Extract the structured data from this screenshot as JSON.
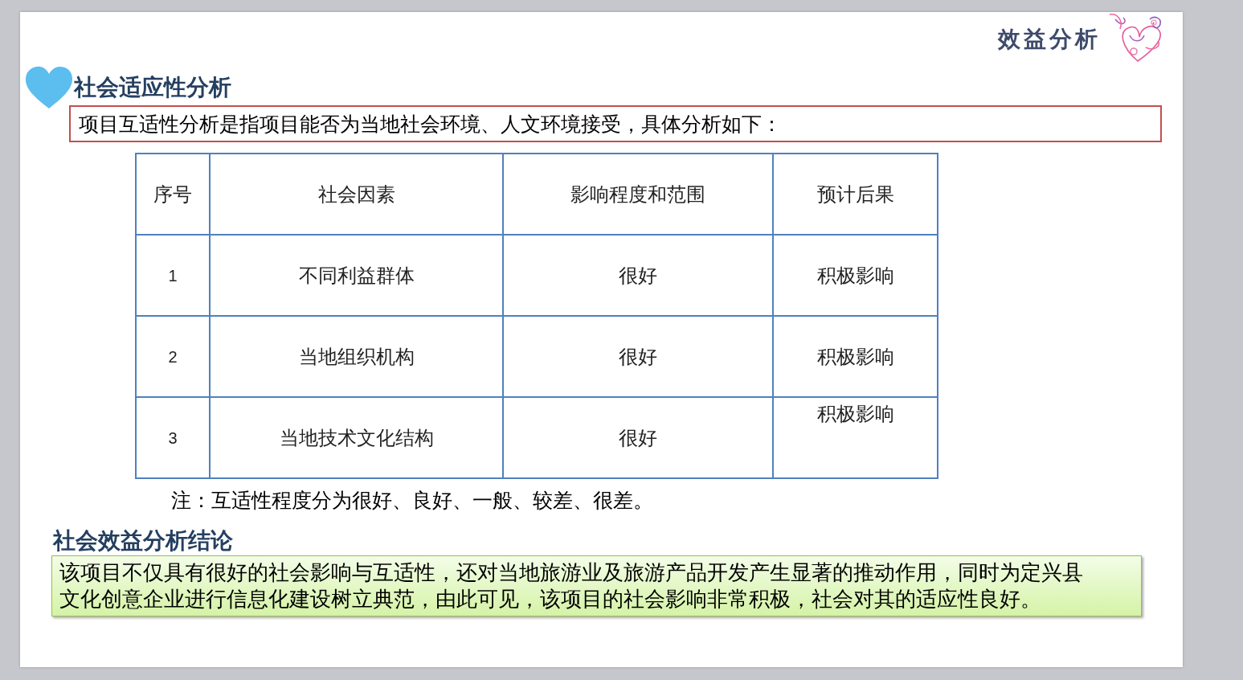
{
  "header": {
    "section_title": "效益分析"
  },
  "adaptability": {
    "heading": "社会适应性分析",
    "intro": "项目互适性分析是指项目能否为当地社会环境、人文环境接受，具体分析如下：",
    "table": {
      "columns": [
        "序号",
        "社会因素",
        "影响程度和范围",
        "预计后果"
      ],
      "rows": [
        [
          "1",
          "不同利益群体",
          "很好",
          "积极影响"
        ],
        [
          "2",
          "当地组织机构",
          "很好",
          "积极影响"
        ],
        [
          "3",
          "当地技术文化结构",
          "很好",
          "积极影响"
        ]
      ]
    },
    "note": "注：互适性程度分为很好、良好、一般、较差、很差。"
  },
  "conclusion": {
    "heading": "社会效益分析结论",
    "lines": [
      "该项目不仅具有很好的社会影响与互适性，还对当地旅游业及旅游产品开发产生显著的推动作用，同时为定兴县",
      "文化创意企业进行信息化建设树立典范，由此可见，该项目的社会影响非常积极，社会对其的适应性良好。"
    ]
  }
}
